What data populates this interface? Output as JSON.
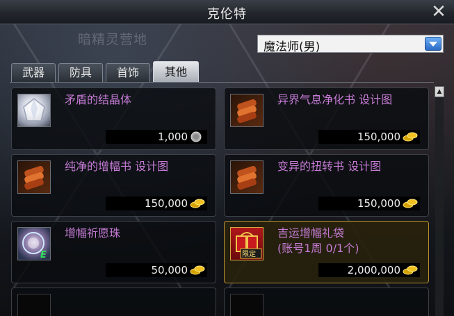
{
  "window": {
    "title": "克伦特",
    "background_label": "暗精灵营地"
  },
  "class_select": {
    "value": "魔法师(男)"
  },
  "tabs": [
    {
      "label": "武器",
      "active": false
    },
    {
      "label": "防具",
      "active": false
    },
    {
      "label": "首饰",
      "active": false
    },
    {
      "label": "其他",
      "active": true
    }
  ],
  "items": [
    {
      "name": "矛盾的结晶体",
      "price": "1,000",
      "currency": "silver-coin-icon",
      "icon": "crystal-icon"
    },
    {
      "name": "异界气息净化书  设计图",
      "price": "150,000",
      "currency": "gold-coin-icon",
      "icon": "scroll-book-icon"
    },
    {
      "name": "纯净的增幅书  设计图",
      "price": "150,000",
      "currency": "gold-coin-icon",
      "icon": "scroll-book-icon"
    },
    {
      "name": "变异的扭转书  设计图",
      "price": "150,000",
      "currency": "gold-coin-icon",
      "icon": "scroll-book-icon"
    },
    {
      "name": "增幅祈愿珠",
      "price": "50,000",
      "currency": "gold-coin-icon",
      "icon": "wish-orb-icon",
      "icon_badge": "E"
    },
    {
      "name": "吉运增幅礼袋\n(账号1周 0/1个)",
      "price": "2,000,000",
      "currency": "gold-coin-icon",
      "icon": "gift-bag-icon",
      "icon_badge": "限定"
    }
  ],
  "colors": {
    "item_name": "#c57bd4",
    "selected_border": "#b8902f",
    "price_text": "#f0f0f0"
  }
}
